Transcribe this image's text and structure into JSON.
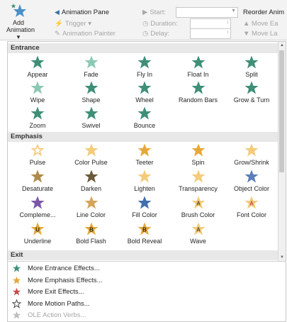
{
  "ribbon": {
    "add_animation": [
      "Add",
      "Animation ▾"
    ],
    "animation_pane": "Animation Pane",
    "trigger": "Trigger ▾",
    "animation_painter": "Animation Painter",
    "start_label": "Start:",
    "duration_label": "Duration:",
    "delay_label": "Delay:",
    "reorder": "Reorder Anim",
    "move_earlier": "▲ Move Ea",
    "move_later": "▼ Move La"
  },
  "sections": {
    "entrance": "Entrance",
    "emphasis": "Emphasis",
    "exit": "Exit"
  },
  "colors": {
    "entrance": "#3f8f78",
    "entrance_light": "#8cc9b4",
    "emphasis": "#e6a83a",
    "emphasis_light": "#f3cb7a",
    "exit": "#c0504d",
    "dark": "#555555"
  },
  "entrance_effects": [
    {
      "label": "Appear",
      "icon": "appear-icon"
    },
    {
      "label": "Fade",
      "icon": "fade-icon"
    },
    {
      "label": "Fly In",
      "icon": "fly-in-icon"
    },
    {
      "label": "Float In",
      "icon": "float-in-icon"
    },
    {
      "label": "Split",
      "icon": "split-icon"
    },
    {
      "label": "Wipe",
      "icon": "wipe-icon"
    },
    {
      "label": "Shape",
      "icon": "shape-icon"
    },
    {
      "label": "Wheel",
      "icon": "wheel-icon"
    },
    {
      "label": "Random Bars",
      "icon": "random-bars-icon"
    },
    {
      "label": "Grow & Turn",
      "icon": "grow-turn-icon"
    },
    {
      "label": "Zoom",
      "icon": "zoom-icon"
    },
    {
      "label": "Swivel",
      "icon": "swivel-icon"
    },
    {
      "label": "Bounce",
      "icon": "bounce-icon"
    }
  ],
  "emphasis_effects": [
    {
      "label": "Pulse",
      "icon": "pulse-icon"
    },
    {
      "label": "Color Pulse",
      "icon": "color-pulse-icon"
    },
    {
      "label": "Teeter",
      "icon": "teeter-icon"
    },
    {
      "label": "Spin",
      "icon": "spin-icon"
    },
    {
      "label": "Grow/Shrink",
      "icon": "grow-shrink-icon"
    },
    {
      "label": "Desaturate",
      "icon": "desaturate-icon"
    },
    {
      "label": "Darken",
      "icon": "darken-icon"
    },
    {
      "label": "Lighten",
      "icon": "lighten-icon"
    },
    {
      "label": "Transparency",
      "icon": "transparency-icon"
    },
    {
      "label": "Object Color",
      "icon": "object-color-icon"
    },
    {
      "label": "Compleme...",
      "icon": "complementary-color-icon"
    },
    {
      "label": "Line Color",
      "icon": "line-color-icon"
    },
    {
      "label": "Fill Color",
      "icon": "fill-color-icon"
    },
    {
      "label": "Brush Color",
      "icon": "brush-color-icon"
    },
    {
      "label": "Font Color",
      "icon": "font-color-icon"
    },
    {
      "label": "Underline",
      "icon": "underline-icon"
    },
    {
      "label": "Bold Flash",
      "icon": "bold-flash-icon"
    },
    {
      "label": "Bold Reveal",
      "icon": "bold-reveal-icon"
    },
    {
      "label": "Wave",
      "icon": "wave-icon"
    }
  ],
  "more_items": [
    {
      "label": "More Entrance Effects...",
      "icon": "entrance-star-icon",
      "enabled": true
    },
    {
      "label": "More Emphasis Effects...",
      "icon": "emphasis-star-icon",
      "enabled": true
    },
    {
      "label": "More Exit Effects...",
      "icon": "exit-star-icon",
      "enabled": true
    },
    {
      "label": "More Motion Paths...",
      "icon": "motion-path-star-icon",
      "enabled": true
    },
    {
      "label": "OLE Action Verbs...",
      "icon": "ole-action-icon",
      "enabled": false
    }
  ]
}
